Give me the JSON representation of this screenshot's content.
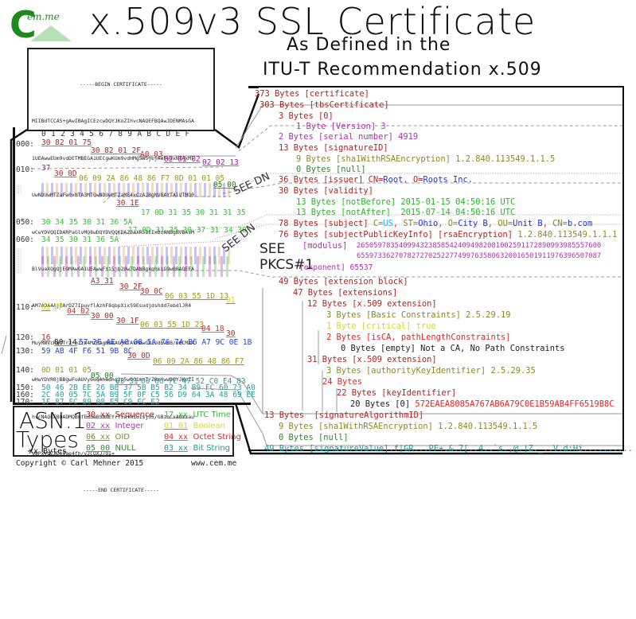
{
  "header": {
    "logo_text": "C",
    "logo_sub": "em.me",
    "title": "x.509v3 SSL Certificate",
    "subtitle_line1": "As Defined in the",
    "subtitle_line2": "ITU-T Recommendation x.509"
  },
  "pem": {
    "lines": [
      "-----BEGIN CERTIFICATE-----",
      "MIIBdTCCAS+gAwIBAgICEzcwDQYJKoZIhvcNAQEFBQAwJDENMAsGA",
      "1UEAwwEUm9vdDETMBEGA1UECgwKUm9vdHMgSW5jLjAeFw0xNTAxMT",
      "UwNDUwMTZaFw0xNTA3MTQwNDUwMTZaME4xCzAJBgNVBAYTAlVTMQ0",
      "wCwYDVQQIDARPaGlvMQ8wDQYDVQQKDAZDaXR5IEIxDzANBgNVBAsM",
      "BlVuaXQgQjEOMAwGA1UEAwwFYi5jb20wTDANBgkqhkiG9w0BAQEFA",
      "AM7ADA4AjEArDZ7IpuvflAzhF8qbpXix59Esudjdshdd7ebdlJR4",
      "MuyRWVcRgUTr2+bzzh4MfPAgMBAAGjMTAvMAwGA1UdEwEB/wQCMAA",
      "wHwYDVR0jBBgwFoAUVy6uqAhadnq2p5w0G1mrT/ZRm4wwDQYJKoZI",
      "hvcNAQEFBQADMQBmfEdSw0SDUEYr7ia+N1u1sjS5/GBzoCxABXxau",
      "V8PxVbZZDpIae4fh/yJCOXJ/OI=",
      "-----END CERTIFICATE-----"
    ]
  },
  "hex": {
    "column_headers": [
      "0",
      "1",
      "2",
      "3",
      "4",
      "5",
      "6",
      "7",
      "8",
      "9",
      "A",
      "B",
      "C",
      "D",
      "E",
      "F"
    ],
    "rows": [
      {
        "addr": "000:"
      },
      {
        "addr": "010:"
      },
      {
        "addr": "050:"
      },
      {
        "addr": "060:"
      },
      {
        "addr": "110:"
      },
      {
        "addr": "120:"
      },
      {
        "addr": "130:"
      },
      {
        "addr": "140:"
      },
      {
        "addr": "150:"
      },
      {
        "addr": "160:"
      },
      {
        "addr": "170:"
      }
    ],
    "bytes": {
      "r000_a": "30 82 01 75",
      "r000_b": "30 82 01 2F",
      "r000_c": "A0 03",
      "r000_d": "02 01 02",
      "r000_e": "02 02 13",
      "r010_a": "37",
      "r010_b": "30 0D",
      "r010_c": "06 09 2A 86 48 86 F7 0D 01 01 05",
      "r010_d": "05 00",
      "r040_a": "30 1E",
      "r040_b": "17 0D 31 35 30 31 31 35",
      "r050_a": "30 34 35 30 31 36 5A",
      "r050_b": "17 0D 31 35 30 37 31 34 30",
      "r060_a": "34 35 30 31 36 5A",
      "r100_a": "A3 31",
      "r100_b": "30 2F",
      "r100_c": "30 0C",
      "r100_d": "06 03 55 1D 13",
      "r100_e": "01",
      "r110_a": "01",
      "r110_b": "FF",
      "r110_c": "04 02",
      "r110_d": "30 00",
      "r110_e": "30 1F",
      "r110_f": "06 03 55 1D 23",
      "r110_g": "04 18",
      "r110_h": "30",
      "r120_a": "16",
      "r120_b": "80 14",
      "r120_c": "57 2E AE A8 08 5A 76 7A B6 A7 9C 0E 1B",
      "r130_a": "59 AB 4F F6 51 9B 8C",
      "r130_b": "30 0D",
      "r130_c": "06 09 2A 86 48 86 F7",
      "r140_a": "0D 01 01 05",
      "r140_b": "05 00",
      "r140_c": "03 31",
      "r140_d": "00 66 7C 47 52 C0 E4 83",
      "r150": "50 46 2B EE 26 BE 37 5B B5 B2 34 B9 FC 60 73 A0",
      "r160": "2C 40 05 7C 5A B9 5F 0F C5 56 D9 64 3A 48 69 EE",
      "r170": "1F 87 FC 89 08 E5 C9 FC E2"
    }
  },
  "annotations": {
    "see_dn_1": "SEE DN",
    "see_dn_2": "SEE DN",
    "see_pkcs_1": "SEE",
    "see_pkcs_2": "PKCS#1"
  },
  "tree": {
    "certificate": "373 Bytes [certificate]",
    "tbs": "303 Bytes [tbsCertificate]",
    "ctx0": "3 Bytes [0]",
    "version": "1 Byte [Version] 3",
    "serial": "2 Bytes [serial number] 4919",
    "sigid": "13 Bytes [signatureID]",
    "sigid_oid": "9 Bytes [sha1WithRSAEncryption] 1.2.840.113549.1.1.5",
    "sigid_null": "0 Bytes [null]",
    "issuer_label": "36 Bytes [issuer] ",
    "issuer_cn_key": "CN=",
    "issuer_cn_val": "Root",
    "issuer_sep": ", ",
    "issuer_o_key": "O=",
    "issuer_o_val": "Roots Inc.",
    "validity": "30 Bytes [validity]",
    "not_before": "13 Bytes [notBefore] 2015-01-15 04:50:16 UTC",
    "not_after": "13 Bytes [notAfter]  2015-07-14 04:50:16 UTC",
    "subject_label": "78 Bytes [subject] ",
    "subject_parts": [
      {
        "key": "C=",
        "val": "US"
      },
      {
        "key": "ST=",
        "val": "Ohio"
      },
      {
        "key": "O=",
        "val": "City B"
      },
      {
        "key": "OU=",
        "val": "Unit B"
      },
      {
        "key": "CN=",
        "val": "b.com"
      }
    ],
    "spki_label": "76 Bytes [subjectPublicKeyInfo] [rsaEncryption] ",
    "spki_oid": "1.2.840.113549.1.1.1",
    "modulus_label": "[modulus]",
    "modulus_line1": "26505978354099432385854240949820810025911728909939855576",
    "modulus_line1b": "00",
    "modulus_line2": "655973362707827270252277499763580632001650191197639650708",
    "modulus_line2b": "7",
    "exponent": "[exponent] 65537",
    "ext_block": "49 Bytes [extension block]",
    "extensions": "47 Bytes [extensions]",
    "ext1": "12 Bytes [x.509 extension]",
    "ext1_oid": "3 Bytes [Basic Constraints] 2.5.29.19",
    "ext1_crit": "1 Byte [critical] true",
    "ext1_val": "2 Bytes [isCA, pathLengthConstraints]",
    "ext1_empty": "0 Bytes [empty] Not a CA, No Path Constraints",
    "ext2": "31 Bytes [x.509 extension]",
    "ext2_oid": "3 Bytes [authorityKeyIdentifier] 2.5.29.35",
    "ext2_oct": "24 Bytes",
    "ext2_keyid": "22 Bytes [keyIdentifier]",
    "ext2_ctx0": "20 Bytes [0] ",
    "ext2_keyid_val": "572EAEA8085A767AB6A79C0E1B59AB4FF6519B8C",
    "sigalg": "13 Bytes  [signatureAlgorithmID]",
    "sigalg_oid": "9 Bytes [sha1WithRSAEncryption] 1.2.840.113549.1.1.5",
    "sigalg_null": "0 Bytes [null]",
    "sigvalue": "49 Bytes [signatureValue].f|GR...PF+.&.7[..4..`s.,@.|Z._..V.d:Hi.........."
  },
  "legend": {
    "title1": "ASN.1",
    "title2": "Types",
    "subtitle": "xx Bytes",
    "items": [
      {
        "code": "30 xx",
        "label": "Sequence",
        "color": "#b22222"
      },
      {
        "code": "02 xx",
        "label": "Integer",
        "color": "#b030b0"
      },
      {
        "code": "06 xx",
        "label": "OID",
        "color": "#8a8a20"
      },
      {
        "code": "05 00",
        "label": "NULL",
        "color": "#2a8a2a"
      },
      {
        "code": "17 xx",
        "label": "UTC Time",
        "color": "#22cc22"
      },
      {
        "code": "01 01",
        "label": "Boolean",
        "color": "#d8d820"
      },
      {
        "code": "04 xx",
        "label": "Octet String",
        "color": "#ee2222"
      },
      {
        "code": "03 xx",
        "label": "Bit String",
        "color": "#1a9a9a"
      }
    ]
  },
  "footer": {
    "copyright": "Copyright © Carl Mehner 2015",
    "website": "www.cem.me"
  }
}
